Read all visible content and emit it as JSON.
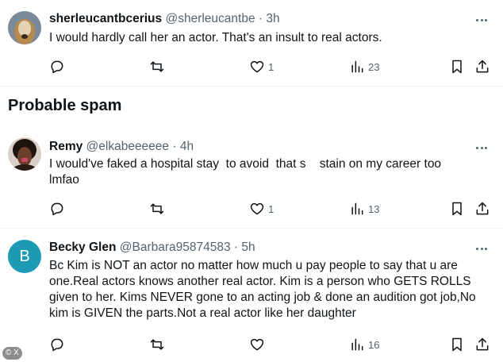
{
  "colors": {
    "text": "#0f1419",
    "muted": "#536471",
    "divider": "#eff3f4",
    "avatar_b": "#1d9bb5"
  },
  "icons": [
    "reply-icon",
    "retweet-icon",
    "like-icon",
    "views-icon",
    "bookmark-icon",
    "share-icon",
    "more-icon"
  ],
  "tweets": [
    {
      "name": "sherleucantbcerius",
      "handle": "@sherleucantbe",
      "dot": "·",
      "time": "3h",
      "text": "I would hardly call her an actor. That's an insult to real actors.",
      "replies": "",
      "retweets": "",
      "likes": "1",
      "views": "23"
    },
    {
      "name": "Remy",
      "handle": "@elkabeeeeee",
      "dot": "·",
      "time": "4h",
      "text": "I would've faked a hospital stay  to avoid  that s    stain on my career too\nlmfao",
      "replies": "",
      "retweets": "",
      "likes": "1",
      "views": "13"
    },
    {
      "name": "Becky Glen",
      "handle": "@Barbara95874583",
      "dot": "·",
      "time": "5h",
      "avatar_letter": "B",
      "text": "Bc Kim is NOT an actor no matter how much u pay people to say that u are one.Real actors knows another real actor. Kim is a person who GETS ROLLS given to her. Kims NEVER gone to an acting job & done an audition got job,No kim is GIVEN the parts.Not a real actor like her daughter",
      "replies": "",
      "retweets": "",
      "likes": "",
      "views": "16"
    }
  ],
  "section": {
    "title": "Probable spam"
  },
  "watermark": "© X"
}
